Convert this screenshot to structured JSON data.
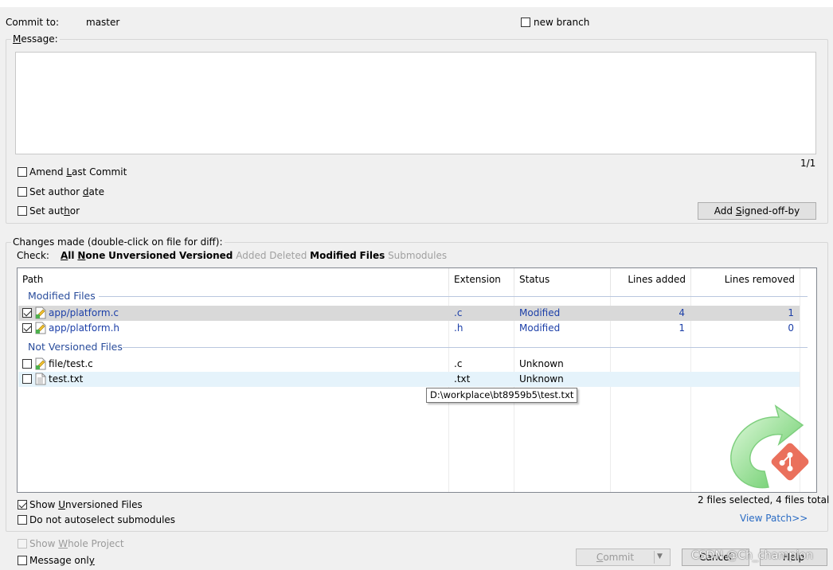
{
  "header": {
    "commit_to_label": "Commit to:",
    "branch": "master",
    "new_branch_label": "new branch"
  },
  "message": {
    "label": "Message:",
    "value": "",
    "counter": "1/1"
  },
  "options": {
    "amend": "Amend Last Commit",
    "set_author_date": "Set author date",
    "set_author": "Set author",
    "add_signed_off": "Add Signed-off-by"
  },
  "changes": {
    "label": "Changes made (double-click on file for diff):",
    "check_label": "Check:",
    "filters": [
      {
        "label": "All",
        "enabled": true
      },
      {
        "label": "None",
        "enabled": true
      },
      {
        "label": "Unversioned",
        "enabled": true
      },
      {
        "label": "Versioned",
        "enabled": true
      },
      {
        "label": "Added",
        "enabled": false
      },
      {
        "label": "Deleted",
        "enabled": false
      },
      {
        "label": "Modified",
        "enabled": true
      },
      {
        "label": "Files",
        "enabled": true
      },
      {
        "label": "Submodules",
        "enabled": false
      }
    ],
    "columns": [
      "Path",
      "Extension",
      "Status",
      "Lines added",
      "Lines removed"
    ],
    "groups": [
      {
        "title": "Modified Files",
        "rows": [
          {
            "checked": true,
            "path": "app/platform.c",
            "ext": ".c",
            "status": "Modified",
            "added": "4",
            "removed": "1",
            "icon": "modified-file-icon"
          },
          {
            "checked": true,
            "path": "app/platform.h",
            "ext": ".h",
            "status": "Modified",
            "added": "1",
            "removed": "0",
            "icon": "modified-file-icon"
          }
        ]
      },
      {
        "title": "Not Versioned Files",
        "rows": [
          {
            "checked": false,
            "path": "file/test.c",
            "ext": ".c",
            "status": "Unknown",
            "added": "",
            "removed": "",
            "icon": "modified-file-icon"
          },
          {
            "checked": false,
            "path": "test.txt",
            "ext": ".txt",
            "status": "Unknown",
            "added": "",
            "removed": "",
            "icon": "text-file-icon"
          }
        ]
      }
    ],
    "tooltip": "D:\\workplace\\bt8959b5\\test.txt",
    "show_unversioned": "Show Unversioned Files",
    "no_autoselect": "Do not autoselect submodules",
    "summary": "2 files selected, 4 files total",
    "view_patch": "View Patch>>"
  },
  "footer": {
    "show_whole_project": "Show Whole Project",
    "message_only": "Message only",
    "commit": "Commit",
    "cancel": "Cancel",
    "help": "Help",
    "watermark": "CSDN @Ch_champion"
  },
  "colors": {
    "accent_blue": "#1c3fa8",
    "group_header": "#2a4d9c",
    "link": "#2b6cc4",
    "logo_green": "#5cc85c",
    "git_red": "#e8614a"
  }
}
